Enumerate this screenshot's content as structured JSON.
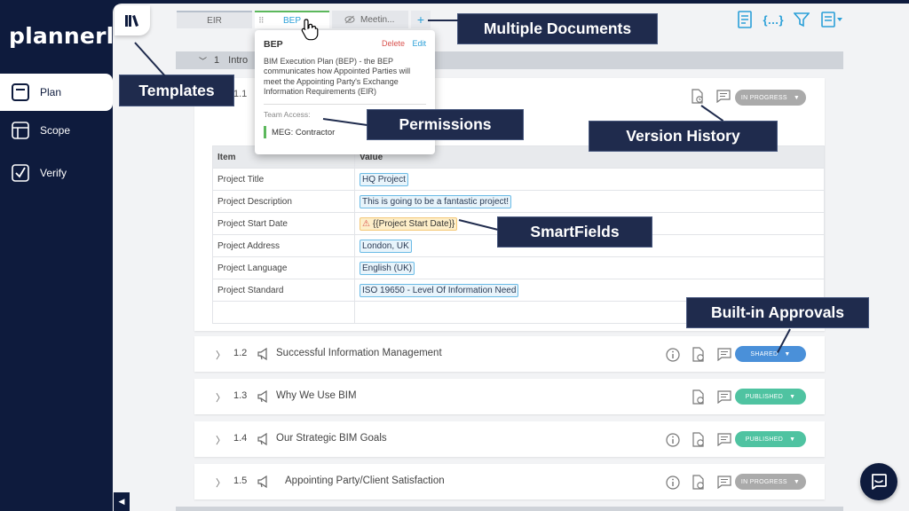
{
  "app": {
    "logo": "plannerly"
  },
  "nav": [
    {
      "label": "Plan",
      "icon": "plan-icon",
      "active": true
    },
    {
      "label": "Scope",
      "icon": "scope-icon",
      "active": false
    },
    {
      "label": "Verify",
      "icon": "verify-icon",
      "active": false
    }
  ],
  "tabs": {
    "eir": "EIR",
    "bep": "BEP",
    "meeting": "Meetin...",
    "add": "+"
  },
  "section": {
    "number": "1",
    "title": "Intro"
  },
  "expanded": {
    "number": "1.1",
    "status": "IN PROGRESS",
    "table": {
      "headers": [
        "Item",
        "Value"
      ],
      "rows": [
        {
          "key": "Project Title",
          "value": "HQ Project"
        },
        {
          "key": "Project Description",
          "value": "This is going to be a fantastic project!"
        },
        {
          "key": "Project Start Date",
          "value": "{{Project Start Date}}"
        },
        {
          "key": "Project Address",
          "value": "London, UK"
        },
        {
          "key": "Project Language",
          "value": "English (UK)"
        },
        {
          "key": "Project Standard",
          "value": "ISO 19650 - Level Of Information Need"
        }
      ]
    }
  },
  "rows": [
    {
      "number": "1.2",
      "title": "Successful Information Management",
      "status": "SHARED",
      "status_color": "#4a90d9"
    },
    {
      "number": "1.3",
      "title": "Why We Use BIM",
      "status": "PUBLISHED",
      "status_color": "#4fc3a1"
    },
    {
      "number": "1.4",
      "title": "Our Strategic BIM Goals",
      "status": "PUBLISHED",
      "status_color": "#4fc3a1"
    },
    {
      "number": "1.5",
      "title": "Appointing Party/Client Satisfaction",
      "status": "IN PROGRESS",
      "status_color": "#aaaaaa"
    }
  ],
  "popover": {
    "title": "BEP",
    "delete": "Delete",
    "edit": "Edit",
    "description": "BIM Execution Plan (BEP) - the BEP communicates how Appointed Parties will meet the Appointing Party's Exchange Information Requirements (EIR)",
    "access_label": "Team Access:",
    "team": "MEG: Contractor"
  },
  "callouts": {
    "multiple_documents": "Multiple Documents",
    "templates": "Templates",
    "permissions": "Permissions",
    "version_history": "Version History",
    "smartfields": "SmartFields",
    "approvals": "Built-in Approvals"
  },
  "colors": {
    "navy": "#0e1b3d",
    "accent": "#2ba0d8",
    "shared": "#4a90d9",
    "published": "#4fc3a1",
    "in_progress": "#aaaaaa"
  }
}
